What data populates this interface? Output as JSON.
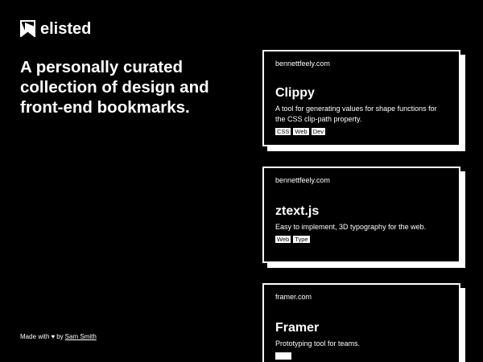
{
  "brand": {
    "name": "elisted",
    "logo_icon": "elisted-bookmark-logo-icon"
  },
  "hero": {
    "headline": "A personally curated collection of design and front-end bookmarks."
  },
  "footer": {
    "made_with": "Made with",
    "heart_icon": "heart-icon",
    "by": "by",
    "author": "Sam Smith"
  },
  "bookmarks": [
    {
      "domain": "bennettfeely.com",
      "title": "Clippy",
      "description": "A tool for generating values for shape functions for the CSS clip-path property.",
      "tags": [
        "CSS",
        "Web",
        "Dev"
      ]
    },
    {
      "domain": "bennettfeely.com",
      "title": "ztext.js",
      "description": "Easy to implement, 3D typography for the web.",
      "tags": [
        "Web",
        "Type"
      ]
    },
    {
      "domain": "framer.com",
      "title": "Framer",
      "description": "Prototyping tool for teams.",
      "tags": [
        ""
      ]
    }
  ],
  "colors": {
    "background": "#000000",
    "foreground": "#ffffff"
  }
}
